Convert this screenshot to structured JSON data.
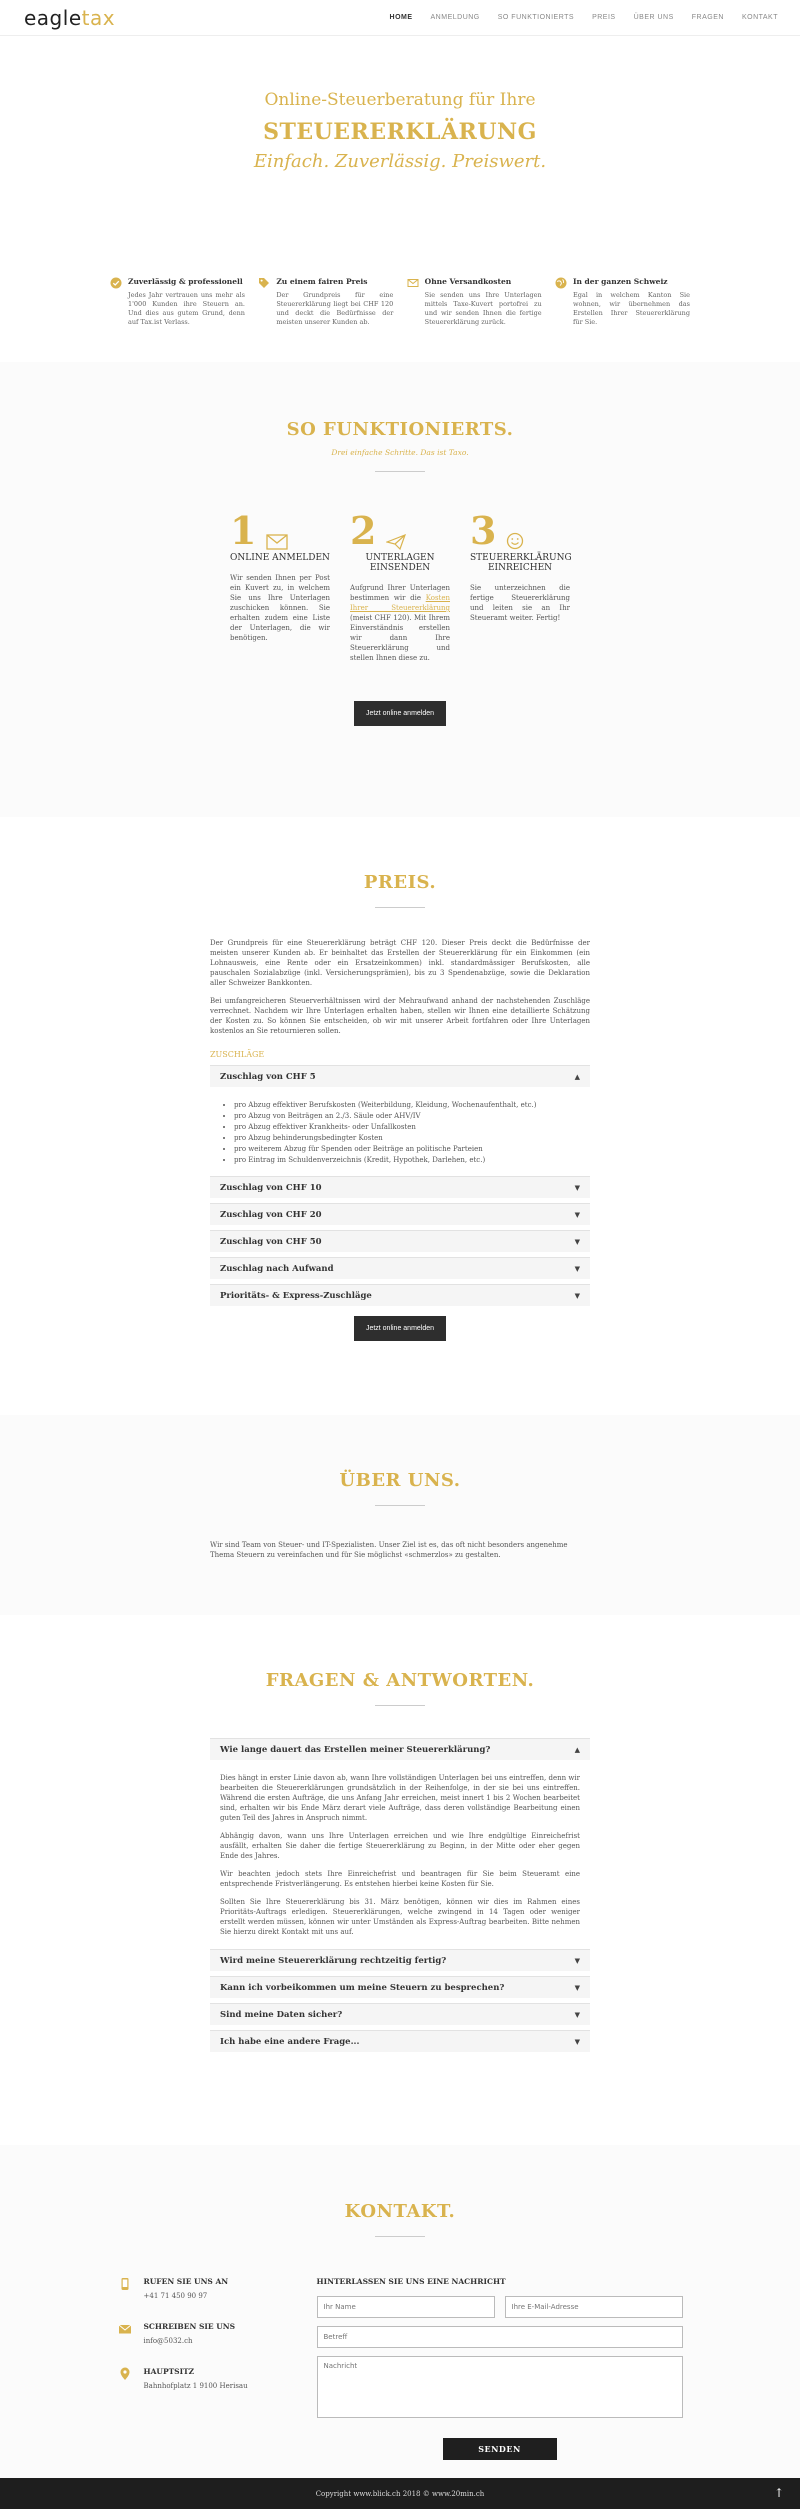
{
  "header": {
    "logo_main": "eagle",
    "logo_accent": "tax",
    "nav": [
      "HOME",
      "ANMELDUNG",
      "SO FUNKTIONIERTS",
      "PREIS",
      "ÜBER UNS",
      "FRAGEN",
      "KONTAKT"
    ]
  },
  "hero": {
    "line1": "Online-Steuerberatung für Ihre",
    "line2": "STEUERERKLÄRUNG",
    "line3": "Einfach. Zuverlässig. Preiswert."
  },
  "features": [
    {
      "icon": "check-circle-icon",
      "title": "Zuverlässig & professionell",
      "text": "Jedes Jahr vertrauen uns mehr als 1'000 Kunden ihre Steuern an. Und dies aus gutem Grund, denn auf Tax.ist Verlass."
    },
    {
      "icon": "tag-icon",
      "title": "Zu einem fairen Preis",
      "text": "Der Grundpreis für eine Steuererklärung liegt bei CHF 120 und deckt die Bedürfnisse der meisten unserer Kunden ab."
    },
    {
      "icon": "envelope-icon",
      "title": "Ohne Versandkosten",
      "text": "Sie senden uns Ihre Unterlagen mittels Taxe-Kuvert portofrei zu und wir senden Ihnen die fertige Steuererklärung zurück."
    },
    {
      "icon": "globe-icon",
      "title": "In der ganzen Schweiz",
      "text": "Egal in welchem Kanton Sie wohnen, wir übernehmen das Erstellen Ihrer Steuererklärung für Sie."
    }
  ],
  "how": {
    "title": "SO FUNKTIONIERTS.",
    "subtitle": "Drei einfache Schritte. Das ist Taxo.",
    "steps": [
      {
        "num": "1",
        "icon": "envelope-icon",
        "title": "ONLINE ANMELDEN",
        "text": "Wir senden Ihnen per Post ein Kuvert zu, in welchem Sie uns Ihre Unterlagen zuschicken können. Sie erhalten zudem eine Liste der Unterlagen, die wir benötigen."
      },
      {
        "num": "2",
        "icon": "paper-plane-icon",
        "title": "UNTERLAGEN EINSENDEN",
        "text_before": "Aufgrund Ihrer Unterlagen bestimmen wir die ",
        "link": "Kosten Ihrer Steuererklärung",
        "text_after": " (meist CHF 120). Mit Ihrem Einverständnis erstellen wir dann Ihre Steuererklärung und stellen Ihnen diese zu."
      },
      {
        "num": "3",
        "icon": "smiley-icon",
        "title": "STEUERERKLÄRUNG EINREICHEN",
        "text": "Sie unterzeichnen die fertige Steuererklärung und leiten sie an Ihr Steueramt weiter. Fertig!"
      }
    ],
    "button": "Jetzt online anmelden"
  },
  "price": {
    "title": "PREIS.",
    "p1": "Der Grundpreis für eine Steuererklärung beträgt CHF 120. Dieser Preis deckt die Bedürfnisse der meisten unserer Kunden ab. Er beinhaltet das Erstellen der Steuererklärung für ein Einkommen (ein Lohnausweis, eine Rente oder ein Ersatzeinkommen) inkl. standardmässiger Berufskosten, alle pauschalen Sozialabzüge (inkl. Versicherungsprämien), bis zu 3 Spendenabzüge, sowie die Deklaration aller Schweizer Bankkonten.",
    "p2": "Bei umfangreicheren Steuerverhältnissen wird der Mehraufwand anhand der nachstehenden Zuschläge verrechnet. Nachdem wir Ihre Unterlagen erhalten haben, stellen wir Ihnen eine detaillierte Schätzung der Kosten zu. So können Sie entscheiden, ob wir mit unserer Arbeit fortfahren oder Ihre Unterlagen kostenlos an Sie retournieren sollen.",
    "zuschlaege_label": "ZUSCHLÄGE",
    "open_item": {
      "title": "Zuschlag von CHF 5",
      "bullets": [
        "pro Abzug effektiver Berufskosten (Weiterbildung, Kleidung, Wochenaufenthalt, etc.)",
        "pro Abzug von Beiträgen an 2./3. Säule oder AHV/IV",
        "pro Abzug effektiver Krankheits- oder Unfallkosten",
        "pro Abzug behinderungsbedingter Kosten",
        "pro weiterem Abzug für Spenden oder Beiträge an politische Parteien",
        "pro Eintrag im Schuldenverzeichnis (Kredit, Hypothek, Darlehen, etc.)"
      ]
    },
    "closed_items": [
      "Zuschlag von CHF 10",
      "Zuschlag von CHF 20",
      "Zuschlag von CHF 50",
      "Zuschlag nach Aufwand",
      "Prioritäts- & Express-Zuschläge"
    ],
    "button": "Jetzt online anmelden"
  },
  "about": {
    "title": "ÜBER UNS.",
    "text": "Wir sind Team von Steuer- und IT-Spezialisten. Unser Ziel ist es, das oft nicht besonders angenehme Thema Steuern zu vereinfachen und für Sie möglichst «schmerzlos» zu gestalten."
  },
  "faq": {
    "title": "FRAGEN & ANTWORTEN.",
    "open_item": {
      "title": "Wie lange dauert das Erstellen meiner Steuererklärung?",
      "paragraphs": [
        "Dies hängt in erster Linie davon ab, wann Ihre vollständigen Unterlagen bei uns eintreffen, denn wir bearbeiten die Steuererklärungen grundsätzlich in der Reihenfolge, in der sie bei uns eintreffen. Während die ersten Aufträge, die uns Anfang Jahr erreichen, meist innert 1 bis 2 Wochen bearbeitet sind, erhalten wir bis Ende März derart viele Aufträge, dass deren vollständige Bearbeitung einen guten Teil des Jahres in Anspruch nimmt.",
        "Abhängig davon, wann uns Ihre Unterlagen erreichen und wie Ihre endgültige Einreichefrist ausfällt, erhalten Sie daher die fertige Steuererklärung zu Beginn, in der Mitte oder eher gegen Ende des Jahres.",
        "Wir beachten jedoch stets Ihre Einreichefrist und beantragen für Sie beim Steueramt eine entsprechende Fristverlängerung. Es entstehen hierbei keine Kosten für Sie.",
        "Sollten Sie Ihre Steuererklärung bis 31. März benötigen, können wir dies im Rahmen eines Prioritäts-Auftrags erledigen. Steuererklärungen, welche zwingend in 14 Tagen oder weniger erstellt werden müssen, können wir unter Umständen als Express-Auftrag bearbeiten. Bitte nehmen Sie hierzu direkt Kontakt mit uns auf."
      ]
    },
    "closed_items": [
      "Wird meine Steuererklärung rechtzeitig fertig?",
      "Kann ich vorbeikommen um meine Steuern zu besprechen?",
      "Sind meine Daten sicher?",
      "Ich habe eine andere Frage..."
    ]
  },
  "contact": {
    "title": "KONTAKT.",
    "items": [
      {
        "icon": "phone-icon",
        "title": "RUFEN SIE UNS AN",
        "value": "+41 71 450 90 97"
      },
      {
        "icon": "envelope-icon",
        "title": "SCHREIBEN SIE UNS",
        "value": "info@5032.ch"
      },
      {
        "icon": "map-pin-icon",
        "title": "HAUPTSITZ",
        "value": "Bahnhofplatz 1 9100 Herisau"
      }
    ],
    "form_title": "HINTERLASSEN SIE UNS EINE NACHRICHT",
    "name_placeholder": "Ihr Name",
    "email_placeholder": "Ihre E-Mail-Adresse",
    "subject_placeholder": "Betreff",
    "message_placeholder": "Nachricht",
    "send": "SENDEN"
  },
  "footer": {
    "text": "Copyright www.blick.ch 2018 © www.20min.ch"
  },
  "colors": {
    "accent": "#d9b34e",
    "dark": "#2e2e2e"
  }
}
